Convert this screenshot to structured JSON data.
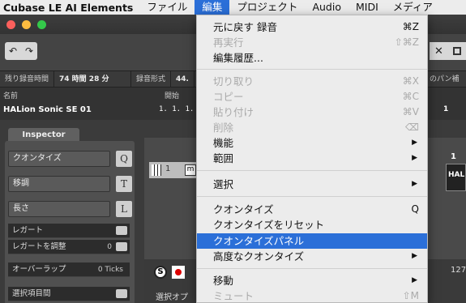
{
  "menubar": {
    "app_name": "Cubase LE AI Elements",
    "items": [
      "ファイル",
      "編集",
      "プロジェクト",
      "Audio",
      "MIDI",
      "メディア"
    ]
  },
  "toolbar": {
    "undo": "↶",
    "redo": "↷",
    "close": "✕"
  },
  "infoline": {
    "remain_label": "残り録音時間",
    "remain_value": "74 時間 28 分",
    "format_label": "録音形式",
    "format_value": "44.",
    "pan_label": "のパン補正"
  },
  "trackinfo": {
    "name_label": "名前",
    "name_value": "HALion Sonic SE 01",
    "start_label": "開始",
    "start_value": "1. 1. 1.",
    "trail_value": "1"
  },
  "inspector": {
    "tab": "Inspector",
    "buttons": [
      {
        "label": "クオンタイズ",
        "key": "Q"
      },
      {
        "label": "移調",
        "key": "T"
      },
      {
        "label": "長さ",
        "key": "L"
      }
    ],
    "rows": [
      {
        "label": "レガート",
        "value": ""
      },
      {
        "label": "レガートを調整",
        "value": "0"
      },
      {
        "label": "オーバーラップ",
        "value": "0 Ticks"
      },
      {
        "label": "選択項目間",
        "value": ""
      }
    ]
  },
  "arrange": {
    "track_num": "1",
    "track_label": "1",
    "hal_label": "HAL",
    "select_option": "選択オプ",
    "num_127": "127"
  },
  "edit_menu": {
    "items": [
      {
        "label": "元に戻す 録音",
        "shortcut": "⌘Z",
        "disabled": false
      },
      {
        "label": "再実行",
        "shortcut": "⇧⌘Z",
        "disabled": true
      },
      {
        "label": "編集履歴...",
        "shortcut": "",
        "disabled": false
      },
      {
        "label": "切り取り",
        "shortcut": "⌘X",
        "disabled": true
      },
      {
        "label": "コピー",
        "shortcut": "⌘C",
        "disabled": true
      },
      {
        "label": "貼り付け",
        "shortcut": "⌘V",
        "disabled": true
      },
      {
        "label": "削除",
        "shortcut": "⌫",
        "disabled": true
      },
      {
        "label": "機能",
        "shortcut": "▶",
        "disabled": false
      },
      {
        "label": "範囲",
        "shortcut": "▶",
        "disabled": false
      },
      {
        "label": "選択",
        "shortcut": "▶",
        "disabled": false
      },
      {
        "label": "クオンタイズ",
        "shortcut": "Q",
        "disabled": false
      },
      {
        "label": "クオンタイズをリセット",
        "shortcut": "",
        "disabled": false
      },
      {
        "label": "クオンタイズパネル",
        "shortcut": "",
        "disabled": false,
        "highlighted": true
      },
      {
        "label": "高度なクオンタイズ",
        "shortcut": "▶",
        "disabled": false
      },
      {
        "label": "移動",
        "shortcut": "▶",
        "disabled": false
      },
      {
        "label": "ミュート",
        "shortcut": "⇧M",
        "disabled": true
      }
    ]
  },
  "colors": {
    "highlight": "#2b6fd8",
    "menu_bg": "#ececec"
  }
}
